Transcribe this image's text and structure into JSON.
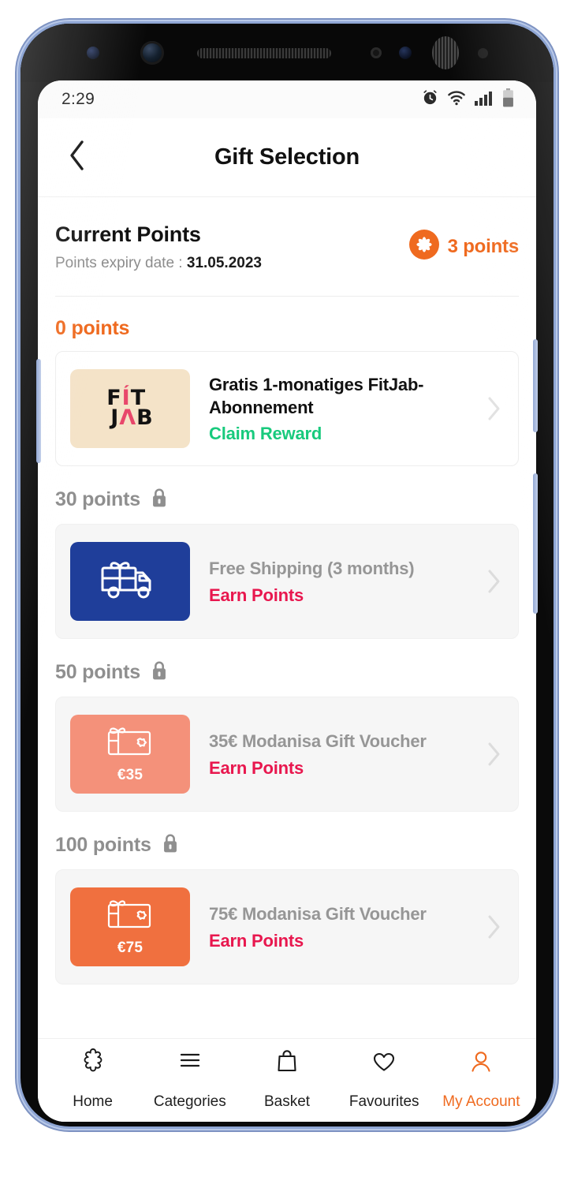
{
  "status_bar": {
    "time": "2:29",
    "icons": [
      "alarm-clock-icon",
      "wifi-icon",
      "cellular-signal-icon",
      "battery-icon"
    ]
  },
  "header": {
    "title": "Gift Selection",
    "back_icon": "chevron-left-icon"
  },
  "points_summary": {
    "title": "Current Points",
    "expiry_prefix": "Points expiry date : ",
    "expiry_date": "31.05.2023",
    "balance_text": "3 points",
    "balance_icon": "rosette-points-icon",
    "accent_color": "#ef6a1f"
  },
  "tiers": [
    {
      "label": "0 points",
      "locked": false,
      "lock_icon": null,
      "reward": {
        "title": "Gratis 1-monatiges FitJab-Abonnement",
        "action": "Claim Reward",
        "action_color": "#18ca7d",
        "thumb_type": "fitjab-logo",
        "thumb_bg": "#f4e3c8",
        "logo_line1": [
          "F",
          "Í",
          "T"
        ],
        "logo_line2": [
          "J",
          "Λ",
          "B"
        ],
        "chevron_icon": "chevron-right-icon"
      }
    },
    {
      "label": "30 points",
      "locked": true,
      "lock_icon": "lock-icon",
      "reward": {
        "title": "Free Shipping (3 months)",
        "action": "Earn Points",
        "action_color": "#e8174e",
        "thumb_type": "gift-truck-icon",
        "thumb_bg": "#1f3e9a",
        "amount_label": null,
        "chevron_icon": "chevron-right-icon"
      }
    },
    {
      "label": "50 points",
      "locked": true,
      "lock_icon": "lock-icon",
      "reward": {
        "title": "35€ Modanisa Gift Voucher",
        "action": "Earn Points",
        "action_color": "#e8174e",
        "thumb_type": "gift-voucher-icon",
        "thumb_bg": "#f4917a",
        "amount_label": "€35",
        "chevron_icon": "chevron-right-icon"
      }
    },
    {
      "label": "100 points",
      "locked": true,
      "lock_icon": "lock-icon",
      "reward": {
        "title": "75€ Modanisa Gift Voucher",
        "action": "Earn Points",
        "action_color": "#e8174e",
        "thumb_type": "gift-voucher-icon",
        "thumb_bg": "#f0703f",
        "amount_label": "€75",
        "chevron_icon": "chevron-right-icon"
      }
    }
  ],
  "bottom_nav": {
    "active_index": 4,
    "active_color": "#ef6a1f",
    "items": [
      {
        "label": "Home",
        "icon": "rosette-home-icon"
      },
      {
        "label": "Categories",
        "icon": "hamburger-menu-icon"
      },
      {
        "label": "Basket",
        "icon": "shopping-bag-icon"
      },
      {
        "label": "Favourites",
        "icon": "heart-icon"
      },
      {
        "label": "My Account",
        "icon": "person-icon"
      }
    ]
  }
}
